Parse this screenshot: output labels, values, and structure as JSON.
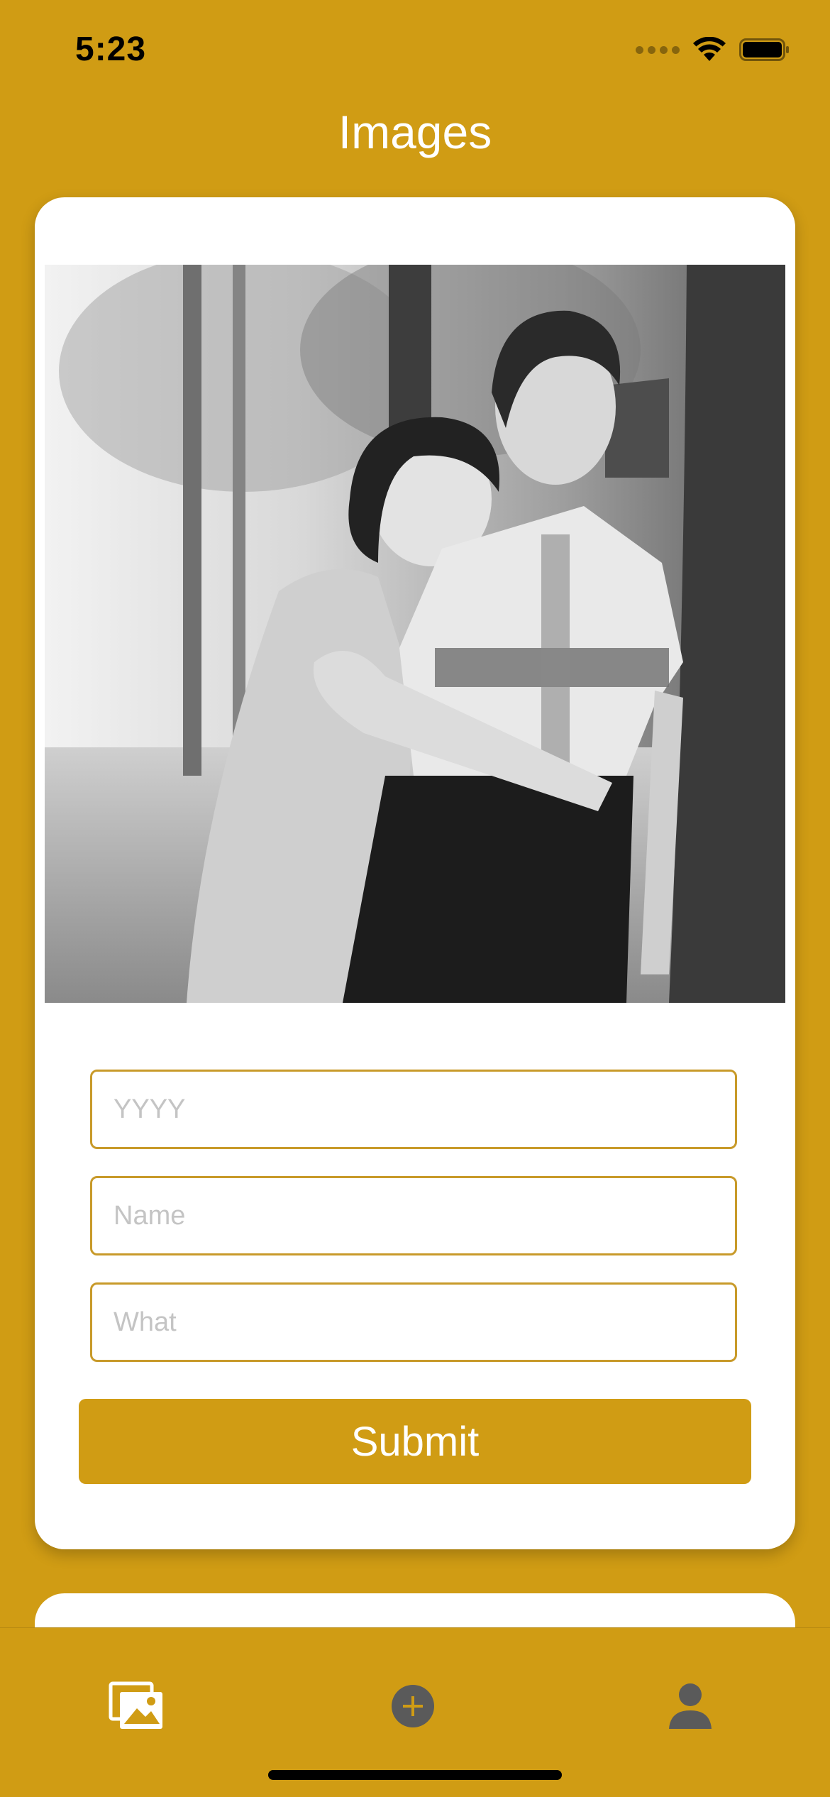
{
  "status_bar": {
    "time": "5:23"
  },
  "header": {
    "title": "Images"
  },
  "form": {
    "year_placeholder": "YYYY",
    "name_placeholder": "Name",
    "what_placeholder": "What",
    "submit_label": "Submit"
  },
  "tab_bar": {
    "items": [
      {
        "icon": "images-icon",
        "active": true
      },
      {
        "icon": "add-circle-icon",
        "active": false
      },
      {
        "icon": "profile-icon",
        "active": false
      }
    ]
  },
  "colors": {
    "accent": "#D09C14",
    "field_border": "#C89A2A",
    "inactive_tab": "#5A5A5A",
    "card": "#FFFFFF"
  }
}
